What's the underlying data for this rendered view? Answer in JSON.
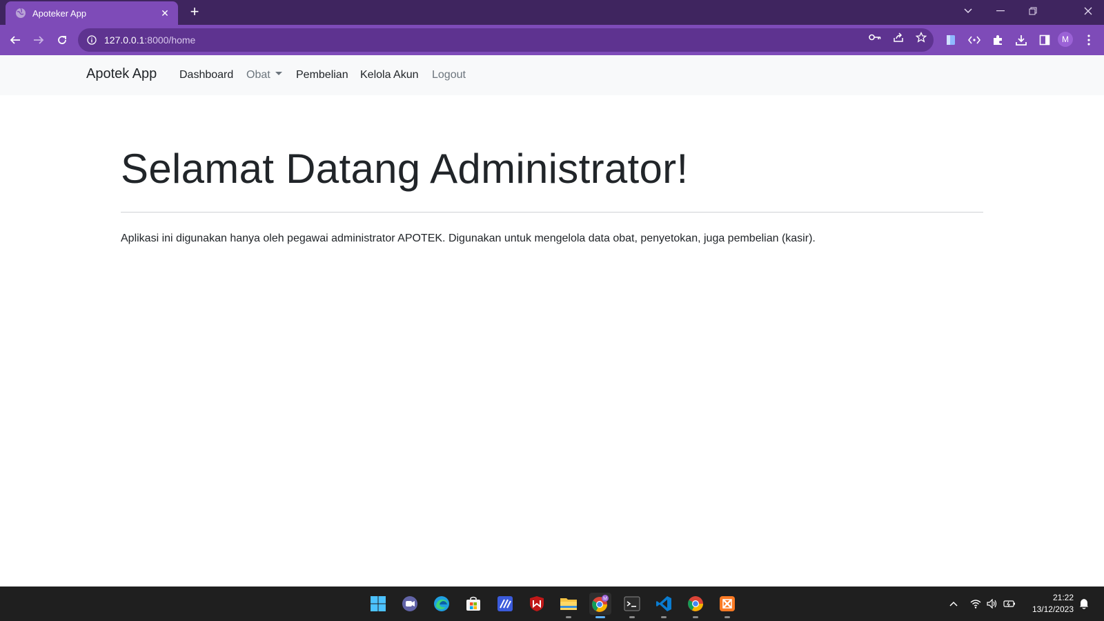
{
  "browser": {
    "tab_title": "Apoteker App",
    "url_host": "127.0.0.1",
    "url_path": ":8000/home",
    "profile_initial": "M"
  },
  "navbar": {
    "brand": "Apotek App",
    "links": [
      {
        "label": "Dashboard",
        "state": "active"
      },
      {
        "label": "Obat",
        "state": "muted",
        "dropdown": true
      },
      {
        "label": "Pembelian",
        "state": "active"
      },
      {
        "label": "Kelola Akun",
        "state": "active"
      },
      {
        "label": "Logout",
        "state": "muted"
      }
    ]
  },
  "main": {
    "heading": "Selamat Datang Administrator!",
    "description": "Aplikasi ini digunakan hanya oleh pegawai administrator APOTEK. Digunakan untuk mengelola data obat, penyetokan, juga pembelian (kasir)."
  },
  "taskbar": {
    "apps": [
      "windows-start",
      "teams-chat",
      "edge",
      "microsoft-store",
      "app-launcher",
      "mcafee",
      "file-explorer",
      "chrome-profile",
      "terminal",
      "vscode",
      "chrome",
      "xampp"
    ],
    "clock_time": "21:22",
    "clock_date": "13/12/2023"
  },
  "colors": {
    "tab_strip": "#3f255f",
    "toolbar": "#7e4bb8",
    "omnibox": "#5e3390",
    "navbar_bg": "#f8f9fa",
    "taskbar": "#1f1f1f"
  }
}
